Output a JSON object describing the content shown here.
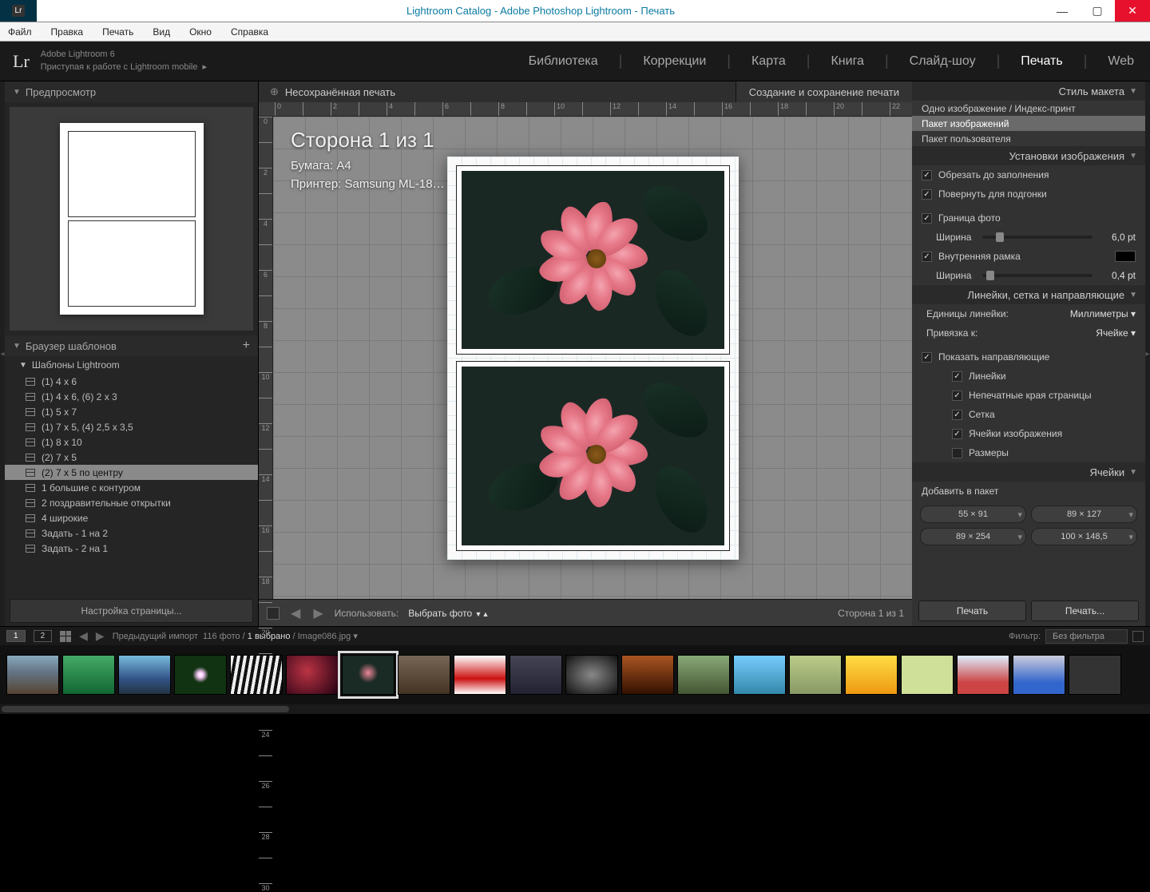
{
  "window": {
    "title": "Lightroom Catalog - Adobe Photoshop Lightroom - Печать"
  },
  "menubar": [
    "Файл",
    "Правка",
    "Печать",
    "Вид",
    "Окно",
    "Справка"
  ],
  "header": {
    "logo": "Lr",
    "line1": "Adobe Lightroom 6",
    "line2": "Приступая к работе с Lightroom mobile",
    "modules": [
      "Библиотека",
      "Коррекции",
      "Карта",
      "Книга",
      "Слайд-шоу",
      "Печать",
      "Web"
    ],
    "active_module": "Печать"
  },
  "left": {
    "preview_title": "Предпросмотр",
    "templates_title": "Браузер шаблонов",
    "group": "Шаблоны Lightroom",
    "items": [
      "(1) 4 x 6",
      "(1) 4 x 6, (6) 2 x 3",
      "(1) 5 x 7",
      "(1) 7 x 5, (4) 2,5 x 3,5",
      "(1) 8 x 10",
      "(2) 7 x 5",
      "(2) 7 x 5 по центру",
      "1 большие с контуром",
      "2 поздравительные открытки",
      "4 широкие",
      "Задать - 1 на 2",
      "Задать - 2 на 1"
    ],
    "selected": "(2) 7 x 5 по центру",
    "page_setup": "Настройка страницы..."
  },
  "center": {
    "unsaved": "Несохранённая печать",
    "make": "Создание и сохранение печати",
    "overlay_page": "Сторона 1 из 1",
    "overlay_paper": "Бумага:  A4",
    "overlay_printer": "Принтер:  Samsung ML-18…",
    "use_label": "Использовать:",
    "use_value": "Выбрать фото",
    "page_info": "Сторона 1 из 1"
  },
  "right": {
    "s1": {
      "title": "Стиль макета",
      "opts": [
        "Одно изображение / Индекс-принт",
        "Пакет изображений",
        "Пакет пользователя"
      ],
      "sel": "Пакет изображений"
    },
    "s2": {
      "title": "Установки изображения",
      "crop": "Обрезать до заполнения",
      "rotate": "Повернуть для подгонки",
      "border": "Граница фото",
      "width": "Ширина",
      "border_val": "6,0",
      "border_unit": "pt",
      "inner": "Внутренняя рамка",
      "inner_val": "0,4",
      "inner_unit": "pt"
    },
    "s3": {
      "title": "Линейки, сетка и направляющие",
      "units_lbl": "Единицы линейки:",
      "units_val": "Миллиметры",
      "snap_lbl": "Привязка к:",
      "snap_val": "Ячейке",
      "show": "Показать направляющие",
      "g": [
        "Линейки",
        "Непечатные края страницы",
        "Сетка",
        "Ячейки изображения",
        "Размеры"
      ],
      "g_off": "Размеры"
    },
    "s4": {
      "title": "Ячейки",
      "add": "Добавить в пакет",
      "btns": [
        "55 × 91",
        "89 × 127",
        "89 × 254",
        "100 × 148,5"
      ]
    },
    "print": "Печать",
    "print_dlg": "Печать..."
  },
  "status": {
    "path_prefix": "Предыдущий импорт",
    "count": "116 фото",
    "selected": "1 выбрано",
    "file": "Image086.jpg",
    "filter_lbl": "Фильтр:",
    "filter_val": "Без фильтра"
  }
}
